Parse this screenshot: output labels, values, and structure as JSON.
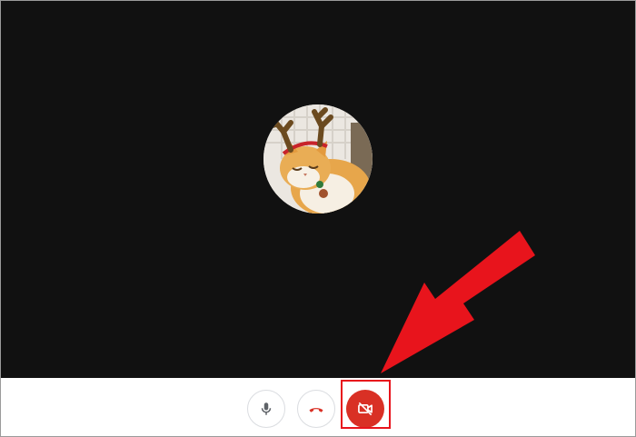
{
  "call": {
    "participant": {
      "avatar_icon": "cat-with-reindeer-antlers-photo"
    },
    "controls": [
      {
        "id": "mic",
        "icon": "microphone-icon",
        "state": "on"
      },
      {
        "id": "hangup",
        "icon": "phone-hangup-icon"
      },
      {
        "id": "camera",
        "icon": "camera-off-icon",
        "state": "off"
      }
    ]
  },
  "annotation": {
    "highlight": "camera-button",
    "arrow_icon": "red-arrow"
  },
  "colors": {
    "video_background": "#111111",
    "control_bar": "#ffffff",
    "button_border": "#dadce0",
    "mic_icon": "#5f6368",
    "hangup_icon": "#d93025",
    "camera_off_accent": "#d93025",
    "annotation_red": "#e8141c"
  }
}
